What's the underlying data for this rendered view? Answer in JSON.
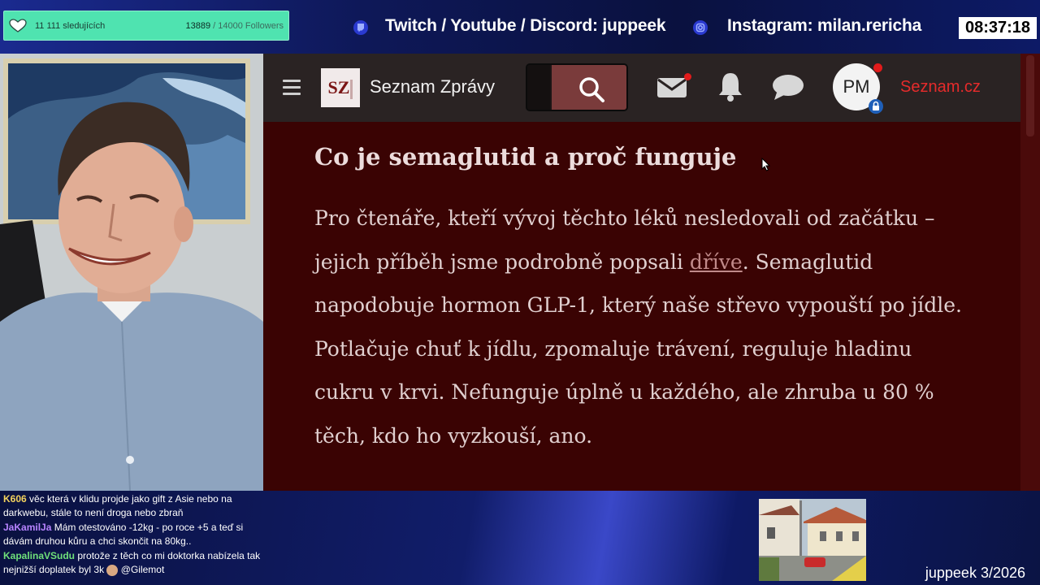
{
  "overlay": {
    "followers_label": "11 111 sledujících",
    "followers_current": "13889",
    "followers_goal": "/ 14000 Followers",
    "social_twitch": "Twitch / Youtube / Discord: juppeek",
    "social_instagram": "Instagram: milan.rericha",
    "clock": "08:37:18",
    "footer": "juppeek 3/2026",
    "accent_color": "#4fe3b0"
  },
  "browser": {
    "brand_logo": "SZ",
    "brand_name": "Seznam Zprávy",
    "avatar_initials": "PM",
    "seznam_link": "Seznam.cz",
    "icons": [
      "menu-icon",
      "search-icon",
      "mail-icon",
      "bell-icon",
      "chat-icon",
      "lock-icon"
    ]
  },
  "article": {
    "title": "Co je semaglutid a proč funguje",
    "p_before_link": "Pro čtenáře, kteří vývoj těchto léků nesledovali od začátku – jejich příběh jsme podrobně popsali ",
    "link_text": "dříve",
    "p_after_link": ". Semaglutid napodobuje hormon GLP-1, který naše střevo vypouští po jídle. Potlačuje chuť k jídlu, zpomaluje trávení, reguluje hladinu cukru v krvi. Nefunguje úplně u každého, ale zhruba u 80 % těch, kdo ho vyzkouší, ano."
  },
  "chat": [
    {
      "user": "K606",
      "text": "věc která v klidu projde jako gift z Asie nebo na darkwebu, stále to není droga nebo zbraň"
    },
    {
      "user": "JaKamilJa",
      "text": "Mám otestováno -12kg - po roce +5 a teď si dávám druhou kůru a chci skončit na 80kg.."
    },
    {
      "user": "KapalinaVSudu",
      "text": "protože z těch co mi doktorka nabízela tak nejnižší doplatek byl 3k",
      "after_emoji": " @Gilemot"
    }
  ]
}
